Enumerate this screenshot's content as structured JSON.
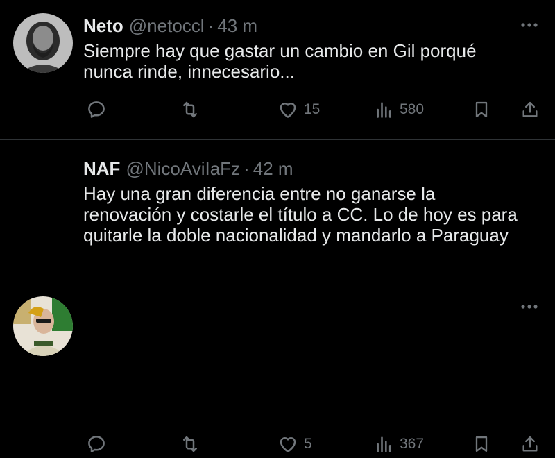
{
  "tweets": [
    {
      "name": "Neto",
      "handle": "@netoccl",
      "separator": "·",
      "time": "43 m",
      "text": "Siempre hay que gastar un cambio en Gil porqué nunca rinde, innecesario...",
      "likes": "15",
      "views": "580"
    },
    {
      "name": "NAF",
      "handle": "@NicoAviIaFz",
      "separator": "·",
      "time": "42 m",
      "text": "Hay una gran diferencia entre no ganarse la renovación y costarle el título a CC. Lo de hoy es para quitarle la doble nacionalidad y mandarlo a Paraguay",
      "likes": "5",
      "views": "367"
    }
  ],
  "colors": {
    "background": "#000000",
    "primary_text": "#e7e9ea",
    "secondary_text": "#71767b",
    "divider": "#2f3336"
  },
  "icons": {
    "reply": "speech-bubble-icon",
    "retweet": "retweet-arrows-icon",
    "like": "heart-icon",
    "views": "bar-chart-icon",
    "bookmark": "bookmark-icon",
    "share": "share-upload-icon",
    "more": "three-dots-icon"
  }
}
